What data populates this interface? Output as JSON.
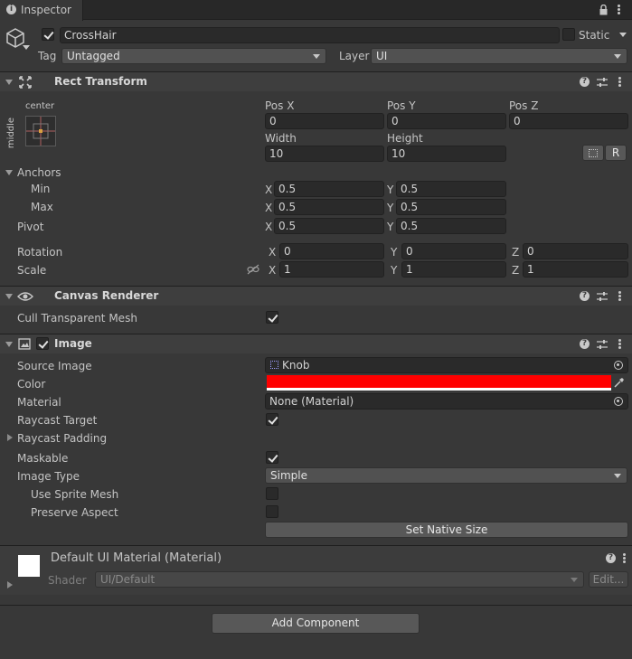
{
  "tab": {
    "title": "Inspector"
  },
  "object": {
    "name": "CrossHair",
    "active": true,
    "static_label": "Static",
    "static_checked": false,
    "tag_label": "Tag",
    "tag_value": "Untagged",
    "layer_label": "Layer",
    "layer_value": "UI"
  },
  "rect_transform": {
    "title": "Rect Transform",
    "anchor_h": "center",
    "anchor_v": "middle",
    "pos_x_label": "Pos X",
    "pos_y_label": "Pos Y",
    "pos_z_label": "Pos Z",
    "pos_x": "0",
    "pos_y": "0",
    "pos_z": "0",
    "width_label": "Width",
    "height_label": "Height",
    "width": "10",
    "height": "10",
    "raw_button": "R",
    "anchors_label": "Anchors",
    "min_label": "Min",
    "max_label": "Max",
    "min_x": "0.5",
    "min_y": "0.5",
    "max_x": "0.5",
    "max_y": "0.5",
    "pivot_label": "Pivot",
    "pivot_x": "0.5",
    "pivot_y": "0.5",
    "rotation_label": "Rotation",
    "rot_x": "0",
    "rot_y": "0",
    "rot_z": "0",
    "scale_label": "Scale",
    "scale_x": "1",
    "scale_y": "1",
    "scale_z": "1",
    "x": "X",
    "y": "Y",
    "z": "Z"
  },
  "canvas_renderer": {
    "title": "Canvas Renderer",
    "cull_label": "Cull Transparent Mesh",
    "cull_checked": true
  },
  "image": {
    "title": "Image",
    "enabled": true,
    "source_image_label": "Source Image",
    "source_image_value": "Knob",
    "color_label": "Color",
    "color_value": "#ff0000",
    "material_label": "Material",
    "material_value": "None (Material)",
    "raycast_target_label": "Raycast Target",
    "raycast_target_checked": true,
    "raycast_padding_label": "Raycast Padding",
    "maskable_label": "Maskable",
    "maskable_checked": true,
    "image_type_label": "Image Type",
    "image_type_value": "Simple",
    "use_sprite_mesh_label": "Use Sprite Mesh",
    "preserve_aspect_label": "Preserve Aspect",
    "set_native_size": "Set Native Size"
  },
  "material_asset": {
    "title": "Default UI Material (Material)",
    "shader_label": "Shader",
    "shader_value": "UI/Default",
    "edit_button": "Edit..."
  },
  "add_component": "Add Component"
}
